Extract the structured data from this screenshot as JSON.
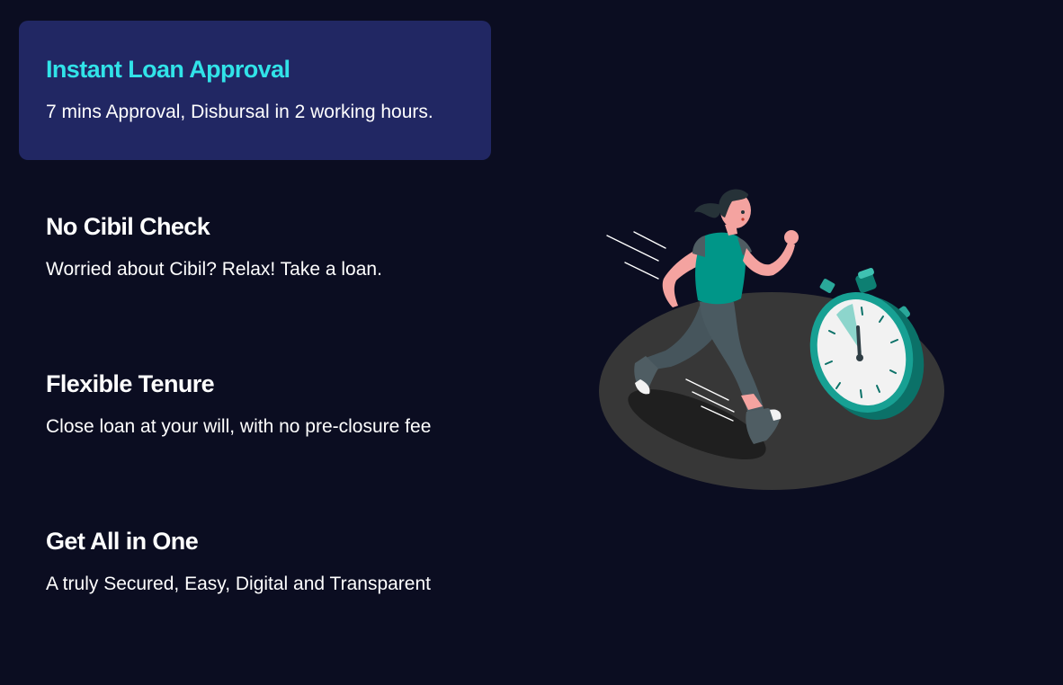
{
  "features": [
    {
      "title": "Instant Loan Approval",
      "description": "7 mins Approval, Disbursal in 2 working hours.",
      "active": true
    },
    {
      "title": "No Cibil Check",
      "description": "Worried about Cibil? Relax! Take a loan.",
      "active": false
    },
    {
      "title": "Flexible Tenure",
      "description": "Close loan at your will, with no pre-closure fee",
      "active": false
    },
    {
      "title": "Get All in One",
      "description": "A truly Secured, Easy, Digital and Transparent",
      "active": false
    }
  ],
  "colors": {
    "background": "#0b0d21",
    "active_card": "#212763",
    "active_title": "#31e3e8",
    "text": "#ffffff",
    "accent_teal": "#009688"
  },
  "illustration": {
    "icon": "running-woman-stopwatch-illustration"
  }
}
